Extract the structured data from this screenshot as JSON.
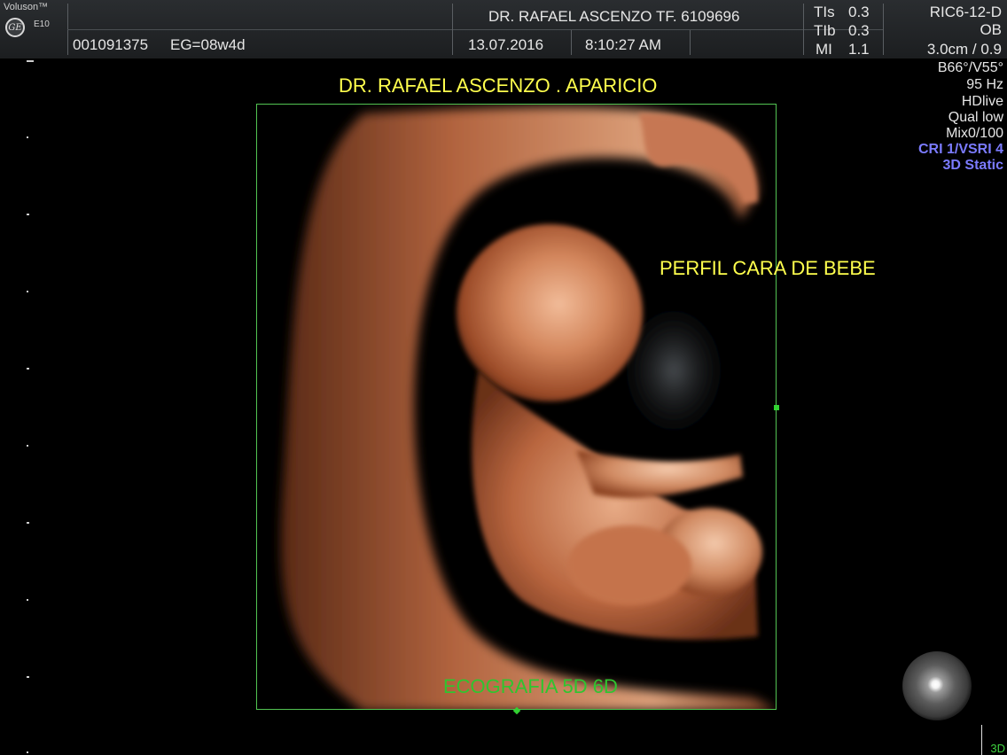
{
  "header": {
    "brand": "Voluson™",
    "model": "E10",
    "logo": "GE",
    "patient_id": "001091375",
    "gestational_age": "EG=08w4d",
    "doctor": "DR. RAFAEL ASCENZO TF. 6109696",
    "date": "13.07.2016",
    "time": "8:10:27 AM",
    "thermal_index": [
      {
        "label": "TIs",
        "value": "0.3"
      },
      {
        "label": "TIb",
        "value": "0.3"
      },
      {
        "label": "MI",
        "value": "1.1"
      }
    ],
    "probe": "RIC6-12-D",
    "preset": "OB",
    "depth": "3.0cm / 0.9"
  },
  "params": [
    {
      "text": "B66°/V55°",
      "color": "#e6e6e6"
    },
    {
      "text": "95 Hz",
      "color": "#e6e6e6"
    },
    {
      "text": "HDlive",
      "color": "#e6e6e6"
    },
    {
      "text": "Qual low",
      "color": "#e6e6e6"
    },
    {
      "text": "Mix0/100",
      "color": "#e6e6e6"
    },
    {
      "text": "CRI 1/VSRI 4",
      "color": "#7b7bff"
    },
    {
      "text": "3D Static",
      "color": "#7b7bff"
    }
  ],
  "overlays": {
    "doctor_name": "DR. RAFAEL ASCENZO . APARICIO",
    "annotation": "PERFIL CARA DE BEBE",
    "watermark": "ECOGRAFIA 5D 6D"
  },
  "mode": "3D",
  "colors": {
    "roi_border": "#52c452",
    "overlay_yellow": "#ffff4d",
    "overlay_green": "#2fc52f",
    "params_blue": "#7b7bff"
  }
}
